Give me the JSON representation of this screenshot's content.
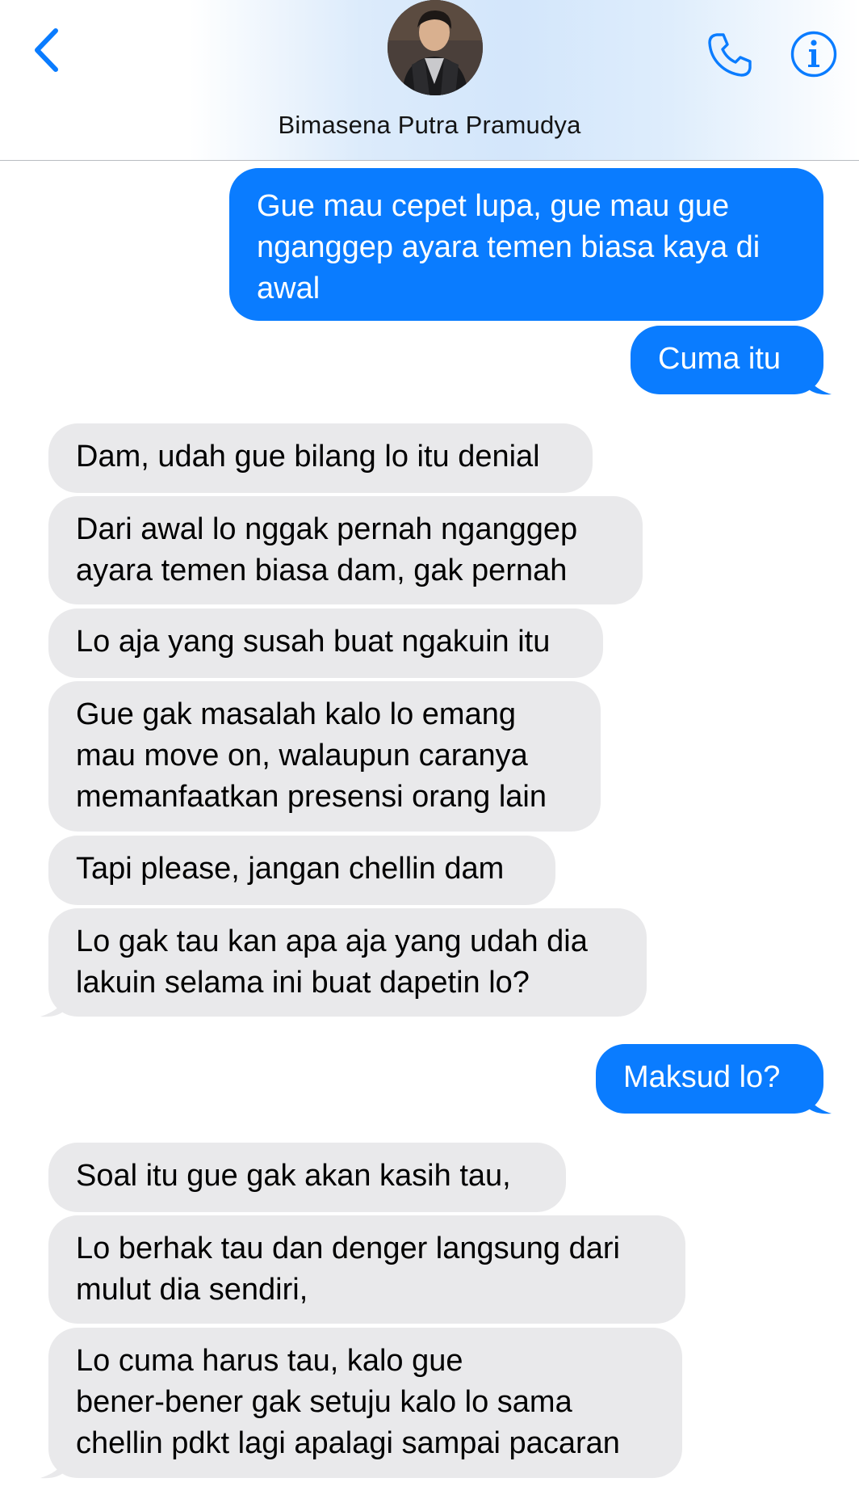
{
  "header": {
    "contact_name": "Bimasena Putra Pramudya",
    "back_icon": "chevron-left-icon",
    "call_icon": "phone-icon",
    "info_icon": "info-icon",
    "accent_color": "#0a7cff"
  },
  "messages": [
    {
      "direction": "outgoing",
      "lines": [
        "Gue mau cepet lupa, gue mau gue",
        "nganggep ayara temen biasa kaya di",
        "awal"
      ]
    },
    {
      "direction": "outgoing",
      "lines": [
        "Cuma itu"
      ]
    },
    {
      "direction": "incoming",
      "lines": [
        "Dam, udah gue bilang lo itu denial"
      ]
    },
    {
      "direction": "incoming",
      "lines": [
        "Dari awal lo nggak pernah nganggep",
        "ayara temen biasa dam, gak pernah"
      ]
    },
    {
      "direction": "incoming",
      "lines": [
        "Lo aja yang susah buat ngakuin itu"
      ]
    },
    {
      "direction": "incoming",
      "lines": [
        "Gue gak masalah kalo lo emang",
        "mau move on, walaupun caranya",
        "memanfaatkan presensi orang lain"
      ]
    },
    {
      "direction": "incoming",
      "lines": [
        "Tapi please, jangan chellin dam"
      ]
    },
    {
      "direction": "incoming",
      "lines": [
        "Lo gak tau kan apa aja yang udah dia",
        "lakuin selama ini buat dapetin lo?"
      ]
    },
    {
      "direction": "outgoing",
      "lines": [
        "Maksud lo?"
      ]
    },
    {
      "direction": "incoming",
      "lines": [
        "Soal itu gue gak akan kasih tau,"
      ]
    },
    {
      "direction": "incoming",
      "lines": [
        "Lo berhak tau dan denger langsung dari",
        "mulut dia sendiri,"
      ]
    },
    {
      "direction": "incoming",
      "lines": [
        "Lo cuma harus tau, kalo gue",
        "bener-bener gak setuju kalo lo sama",
        "chellin pdkt lagi apalagi sampai pacaran"
      ]
    }
  ]
}
